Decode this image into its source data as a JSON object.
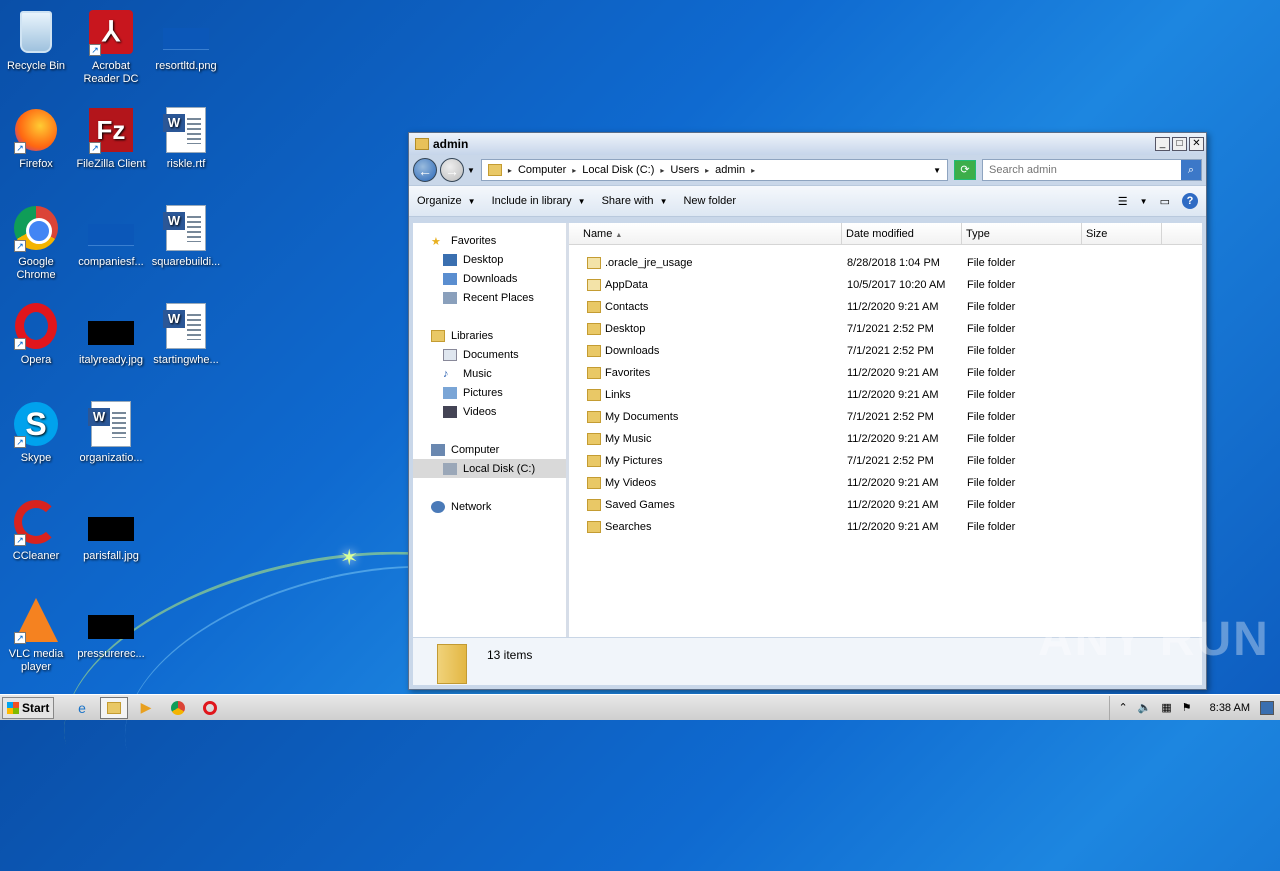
{
  "desktop": {
    "icons": [
      {
        "label": "Recycle Bin",
        "icon": "recycle-bin-icon"
      },
      {
        "label": "Acrobat Reader DC",
        "icon": "acrobat-icon"
      },
      {
        "label": "resortltd.png",
        "icon": "image-file-icon"
      },
      {
        "label": "Firefox",
        "icon": "firefox-icon"
      },
      {
        "label": "FileZilla Client",
        "icon": "filezilla-icon"
      },
      {
        "label": "riskle.rtf",
        "icon": "word-document-icon"
      },
      {
        "label": "Google Chrome",
        "icon": "chrome-icon"
      },
      {
        "label": "companiesf...",
        "icon": "image-file-icon"
      },
      {
        "label": "squarebuildi...",
        "icon": "word-document-icon"
      },
      {
        "label": "Opera",
        "icon": "opera-icon"
      },
      {
        "label": "italyready.jpg",
        "icon": "image-file-icon"
      },
      {
        "label": "startingwhe...",
        "icon": "word-document-icon"
      },
      {
        "label": "Skype",
        "icon": "skype-icon"
      },
      {
        "label": "organizatio...",
        "icon": "word-document-icon"
      },
      {
        "label": "CCleaner",
        "icon": "ccleaner-icon"
      },
      {
        "label": "parisfall.jpg",
        "icon": "image-file-icon"
      },
      {
        "label": "VLC media player",
        "icon": "vlc-icon"
      },
      {
        "label": "pressurerec...",
        "icon": "image-file-icon"
      }
    ]
  },
  "window": {
    "title": "admin",
    "breadcrumbs": [
      "Computer",
      "Local Disk (C:)",
      "Users",
      "admin"
    ],
    "search_placeholder": "Search admin",
    "toolbar": {
      "organize": "Organize",
      "include": "Include in library",
      "share": "Share with",
      "newfolder": "New folder"
    },
    "nav": {
      "favorites": "Favorites",
      "desktop": "Desktop",
      "downloads": "Downloads",
      "recent": "Recent Places",
      "libraries": "Libraries",
      "documents": "Documents",
      "music": "Music",
      "pictures": "Pictures",
      "videos": "Videos",
      "computer": "Computer",
      "localdisk": "Local Disk (C:)",
      "network": "Network"
    },
    "columns": [
      "Name",
      "Date modified",
      "Type",
      "Size"
    ],
    "files": [
      {
        "name": ".oracle_jre_usage",
        "date": "8/28/2018 1:04 PM",
        "type": "File folder"
      },
      {
        "name": "AppData",
        "date": "10/5/2017 10:20 AM",
        "type": "File folder"
      },
      {
        "name": "Contacts",
        "date": "11/2/2020 9:21 AM",
        "type": "File folder"
      },
      {
        "name": "Desktop",
        "date": "7/1/2021 2:52 PM",
        "type": "File folder"
      },
      {
        "name": "Downloads",
        "date": "7/1/2021 2:52 PM",
        "type": "File folder"
      },
      {
        "name": "Favorites",
        "date": "11/2/2020 9:21 AM",
        "type": "File folder"
      },
      {
        "name": "Links",
        "date": "11/2/2020 9:21 AM",
        "type": "File folder"
      },
      {
        "name": "My Documents",
        "date": "7/1/2021 2:52 PM",
        "type": "File folder"
      },
      {
        "name": "My Music",
        "date": "11/2/2020 9:21 AM",
        "type": "File folder"
      },
      {
        "name": "My Pictures",
        "date": "7/1/2021 2:52 PM",
        "type": "File folder"
      },
      {
        "name": "My Videos",
        "date": "11/2/2020 9:21 AM",
        "type": "File folder"
      },
      {
        "name": "Saved Games",
        "date": "11/2/2020 9:21 AM",
        "type": "File folder"
      },
      {
        "name": "Searches",
        "date": "11/2/2020 9:21 AM",
        "type": "File folder"
      }
    ],
    "status": "13 items"
  },
  "taskbar": {
    "start": "Start",
    "clock": "8:38 AM"
  },
  "watermark": "ANY RUN"
}
